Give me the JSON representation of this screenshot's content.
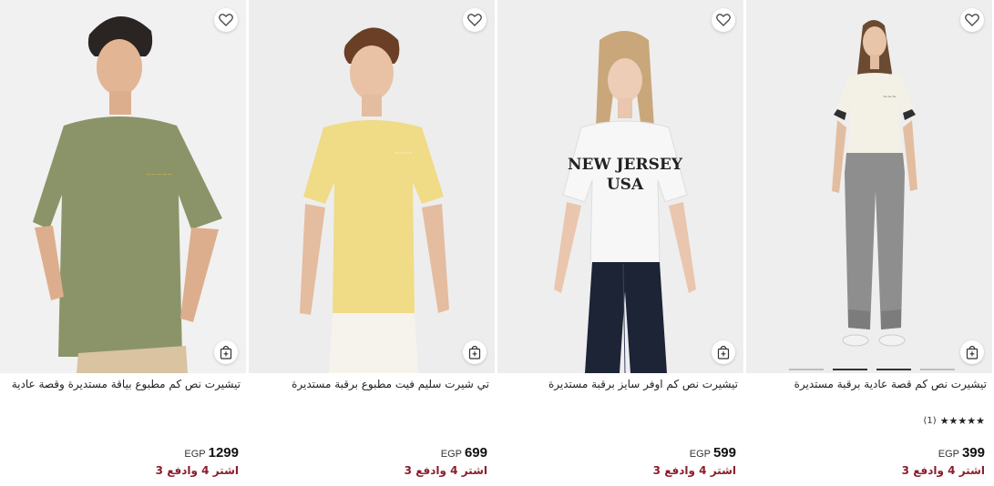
{
  "products": [
    {
      "title": "تيشيرت نص كم مطبوع بياقة مستديرة وقصة عادية",
      "price": "1299",
      "currency": "EGP",
      "promo": "اشتر 4 وادفع 3",
      "shirt_color": "#8b9468",
      "bg_color": "#f1f1f1"
    },
    {
      "title": "تي شيرت سليم فيت مطبوع برقبة مستديرة",
      "price": "699",
      "currency": "EGP",
      "promo": "اشتر 4 وادفع 3",
      "shirt_color": "#f0db86",
      "bg_color": "#ededed"
    },
    {
      "title": "تيشيرت نص كم اوفر سايز برقبة مستديرة",
      "price": "599",
      "currency": "EGP",
      "promo": "اشتر 4 وادفع 3",
      "shirt_color": "#f7f7f7",
      "bg_color": "#eeeeee",
      "shirt_text": [
        "NEW JERSEY",
        "USA"
      ]
    },
    {
      "title": "تيشيرت نص كم قصة عادية برقبة مستديرة",
      "price": "399",
      "currency": "EGP",
      "promo": "اشتر 4 وادفع 3",
      "rating_stars": "★★★★★",
      "rating_count": "(1)",
      "shirt_color": "#f3f0e6",
      "bg_color": "#eeeeee"
    }
  ],
  "icons": {
    "favorite": "heart-icon",
    "add_to_cart": "shopping-bag-plus-icon"
  }
}
